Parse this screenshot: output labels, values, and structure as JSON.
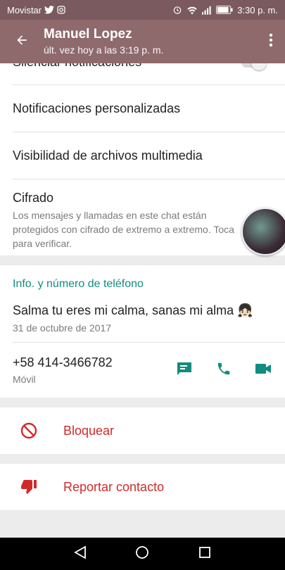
{
  "status_bar": {
    "carrier": "Movistar",
    "time": "3:30 p. m."
  },
  "app_bar": {
    "title": "Manuel Lopez",
    "subtitle": "últ. vez hoy a las 3:19 p. m."
  },
  "settings": {
    "mute_label": "Silenciar notificaciones",
    "custom_notifications": "Notificaciones personalizadas",
    "media_visibility": "Visibilidad de archivos multimedia",
    "encryption_title": "Cifrado",
    "encryption_desc": "Los mensajes y llamadas en este chat están protegidos con cifrado de extremo a extremo. Toca para verificar."
  },
  "info": {
    "section_title": "Info. y número de teléfono",
    "about": "Salma tu eres mi calma, sanas mi alma 👧🏻",
    "about_date": "31 de octubre de 2017",
    "phone": "+58 414-3466782",
    "phone_type": "Móvil"
  },
  "danger": {
    "block": "Bloquear",
    "report": "Reportar contacto"
  },
  "colors": {
    "accent": "#128c7e",
    "danger": "#d12a2a",
    "appbar": "#8e6a6d"
  }
}
